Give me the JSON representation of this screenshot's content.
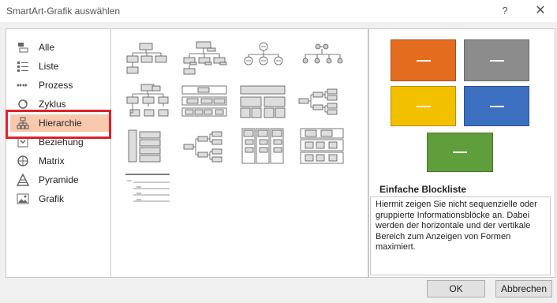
{
  "window": {
    "title": "SmartArt-Grafik auswählen",
    "help_label": "?",
    "close_label": "✕"
  },
  "categories": [
    {
      "label": "Alle",
      "icon": "all-icon"
    },
    {
      "label": "Liste",
      "icon": "list-icon"
    },
    {
      "label": "Prozess",
      "icon": "process-icon"
    },
    {
      "label": "Zyklus",
      "icon": "cycle-icon"
    },
    {
      "label": "Hierarchie",
      "icon": "hierarchy-icon",
      "selected": true
    },
    {
      "label": "Beziehung",
      "icon": "relationship-icon"
    },
    {
      "label": "Matrix",
      "icon": "matrix-icon"
    },
    {
      "label": "Pyramide",
      "icon": "pyramid-icon"
    },
    {
      "label": "Grafik",
      "icon": "picture-icon"
    }
  ],
  "preview": {
    "title": "Einfache Blockliste",
    "description": "Hiermit zeigen Sie nicht sequenzielle oder gruppierte Informationsblöcke an. Dabei werden der horizontale und der vertikale Bereich zum Anzeigen von Formen maximiert.",
    "colors": {
      "orange": "#e46c1e",
      "gray": "#8c8c8c",
      "yellow": "#f3c000",
      "blue": "#3d6fc0",
      "green": "#5f9e3a"
    }
  },
  "buttons": {
    "ok": "OK",
    "cancel": "Abbrechen"
  },
  "colors": {
    "selection": "#f8c9ad",
    "highlight_outline": "#e0212b"
  }
}
